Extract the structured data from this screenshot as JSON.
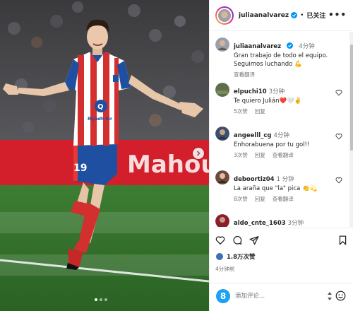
{
  "post": {
    "author": "juliaanalvarez",
    "follow_state": "已关注",
    "more": "•••",
    "caption": {
      "username": "juliaanalvarez",
      "time": "4分钟",
      "text": "Gran trabajo de todo el equipo. Seguimos luchando 💪",
      "translate": "查看翻译"
    },
    "comments": [
      {
        "username": "elpuchi10",
        "time": "3分钟",
        "text": "Te quiero Julián❤️🤍✌️",
        "likes": "5次赞",
        "reply": "回复",
        "translate": ""
      },
      {
        "username": "angeelll_cg",
        "time": "4分钟",
        "text": "Enhorabuena por tu gol!!",
        "likes": "3次赞",
        "reply": "回复",
        "translate": "查看翻译"
      },
      {
        "username": "deboortiz04",
        "time": "1 分钟",
        "text": "La araña que \"la\" pica 👏💫",
        "likes": "8次赞",
        "reply": "回复",
        "translate": "查看翻译"
      },
      {
        "username": "aldo_cnte_1603",
        "time": "3分钟",
        "text": "",
        "likes": "",
        "reply": "",
        "translate": ""
      }
    ],
    "likes_count": "1.8万次赞",
    "posted_time": "4分钟前",
    "composer_placeholder": "添加评论..."
  },
  "photo": {
    "board_text": "Mahou",
    "jersey_brand": "Riyadh Air",
    "shorts_number": "19",
    "carousel_dots": 3,
    "active_dot": 0
  },
  "colors": {
    "verified": "#0095f6",
    "pitch": "#2f6e2c",
    "board_red": "#d21f2b"
  }
}
